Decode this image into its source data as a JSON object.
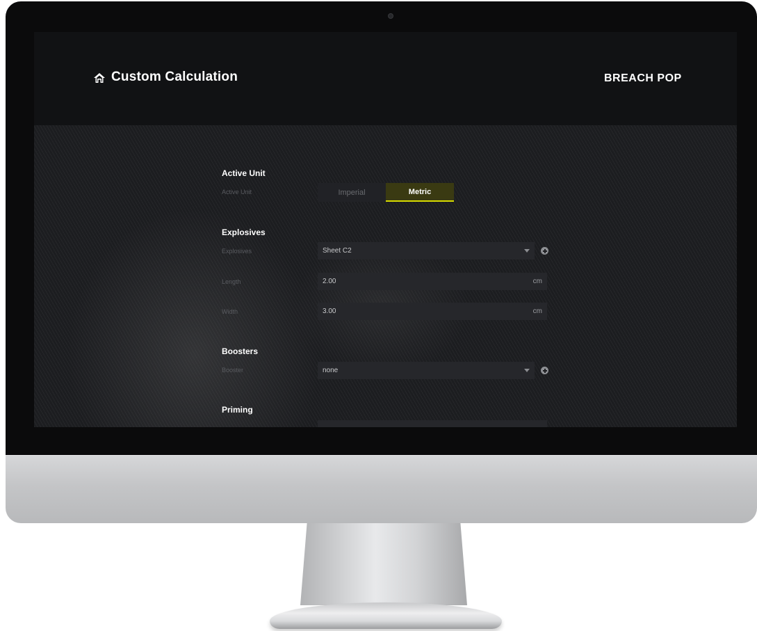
{
  "header": {
    "title": "Custom Calculation",
    "brand": "BREACH POP",
    "home_icon": "home-icon"
  },
  "active_unit": {
    "section_title": "Active Unit",
    "label": "Active Unit",
    "options": [
      "Imperial",
      "Metric"
    ],
    "selected": "Metric"
  },
  "explosives": {
    "section_title": "Explosives",
    "explosive_label": "Explosives",
    "explosive_value": "Sheet C2",
    "length_label": "Length",
    "length_value": "2.00",
    "length_unit": "cm",
    "width_label": "Width",
    "width_value": "3.00",
    "width_unit": "cm"
  },
  "boosters": {
    "section_title": "Boosters",
    "booster_label": "Booster",
    "booster_value": "none"
  },
  "priming": {
    "section_title": "Priming"
  },
  "colors": {
    "accent": "#d8dc00",
    "active_segment_bg": "#3a3a12",
    "topbar_bg": "#111214",
    "content_bg": "#1c1d20"
  }
}
